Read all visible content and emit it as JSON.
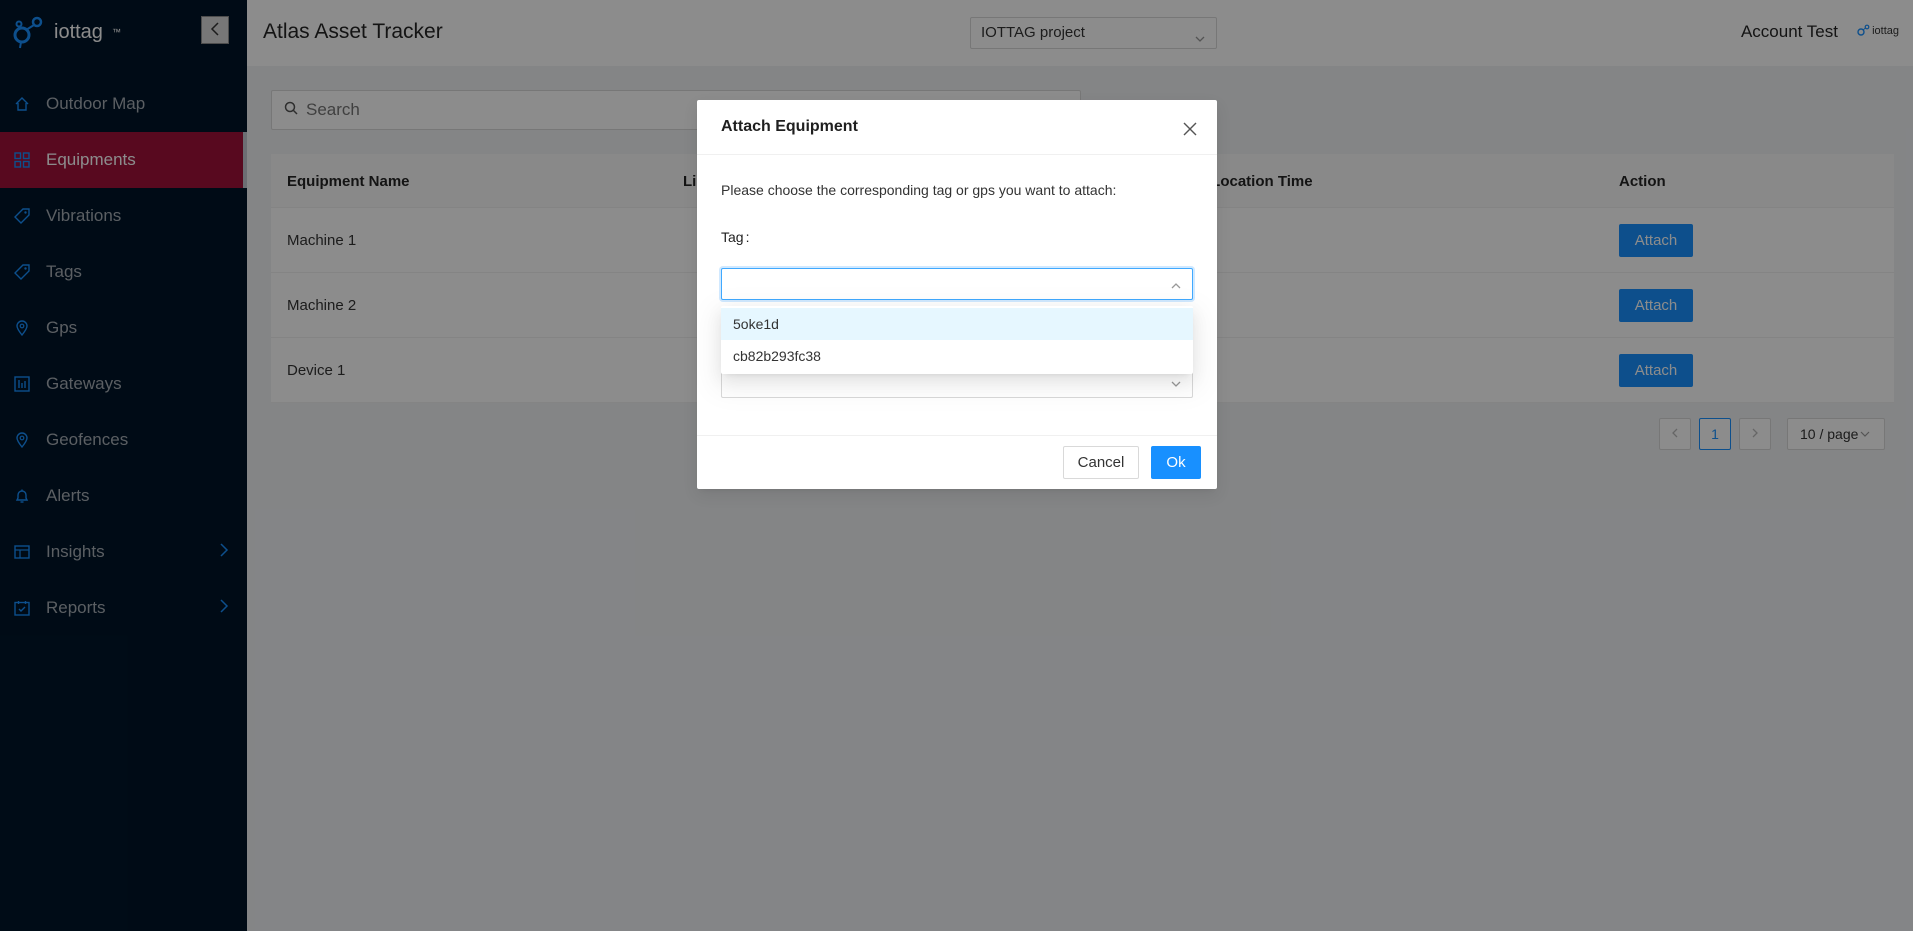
{
  "brand": {
    "name": "iottag",
    "trademark": "™",
    "small_logo": "iottag"
  },
  "sidebar": {
    "collapse_icon": "chevron-left-icon",
    "items": [
      {
        "label": "Outdoor Map",
        "icon": "home-icon",
        "active": false
      },
      {
        "label": "Equipments",
        "icon": "grid-icon",
        "active": true
      },
      {
        "label": "Vibrations",
        "icon": "tag-icon",
        "active": false
      },
      {
        "label": "Tags",
        "icon": "tag-icon",
        "active": false
      },
      {
        "label": "Gps",
        "icon": "location-pin-icon",
        "active": false
      },
      {
        "label": "Gateways",
        "icon": "gateway-icon",
        "active": false
      },
      {
        "label": "Geofences",
        "icon": "location-pin-icon",
        "active": false
      },
      {
        "label": "Alerts",
        "icon": "bell-icon",
        "active": false
      },
      {
        "label": "Insights",
        "icon": "insights-icon",
        "active": false,
        "has_submenu": true
      },
      {
        "label": "Reports",
        "icon": "calendar-icon",
        "active": false,
        "has_submenu": true
      }
    ]
  },
  "header": {
    "title": "Atlas Asset Tracker",
    "project_select": "IOTTAG project",
    "account": "Account Test"
  },
  "search": {
    "placeholder": "Search"
  },
  "table": {
    "columns": [
      "Equipment Name",
      "Li",
      "t Location Time",
      "Action"
    ],
    "rows": [
      {
        "name": "Machine 1",
        "action": "Attach"
      },
      {
        "name": "Machine 2",
        "action": "Attach"
      },
      {
        "name": "Device 1",
        "action": "Attach"
      }
    ]
  },
  "pagination": {
    "current_page": "1",
    "page_size": "10 / page"
  },
  "modal": {
    "title": "Attach Equipment",
    "description": "Please choose the corresponding tag or gps you want to attach:",
    "tag_label": "Tag",
    "tag_label_colon": ":",
    "tag_options": [
      "5oke1d",
      "cb82b293fc38"
    ],
    "cancel_label": "Cancel",
    "ok_label": "Ok"
  },
  "colors": {
    "sidebar_bg": "#001529",
    "active_menu": "#a0113a",
    "primary": "#1890ff",
    "icon_blue": "#1890ff"
  }
}
